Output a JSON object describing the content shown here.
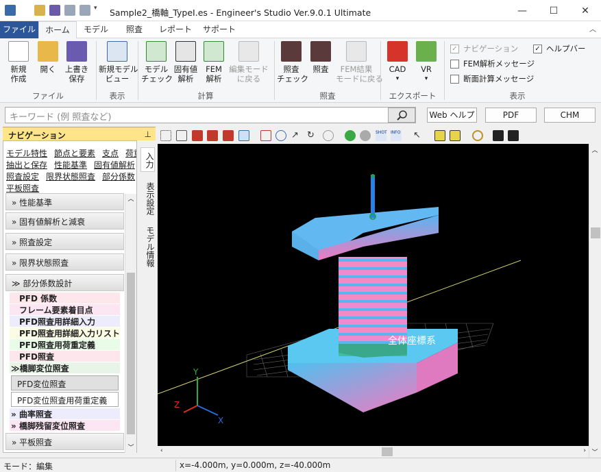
{
  "window": {
    "title": "Sample2_橋軸_TypeI.es - Engineer's Studio Ver.9.0.1 Ultimate",
    "min_icon": "minimize-icon",
    "max_icon": "maximize-icon",
    "close_icon": "close-icon"
  },
  "menu": {
    "tabs": [
      "ファイル",
      "ホーム",
      "モデル",
      "照査",
      "レポート",
      "サポート"
    ]
  },
  "ribbon": {
    "buttons": [
      "新規\n作成",
      "開く",
      "上書き\n保存",
      "新規モデル\nビュー",
      "モデル\nチェック",
      "固有値\n解析",
      "FEM\n解析",
      "編集モード\nに戻る",
      "照査\nチェック",
      "照査",
      "FEM結果\nモードに戻る",
      "CAD",
      "VR"
    ],
    "groups": [
      "ファイル",
      "表示",
      "計算",
      "照査",
      "エクスポート",
      "表示"
    ],
    "checks": {
      "navigation": "ナビゲーション",
      "help_bar": "ヘルプバー",
      "fem_msg": "FEM解析メッセージ",
      "section_msg": "断面計算メッセージ"
    }
  },
  "search": {
    "placeholder": "キーワード (例 照査など)",
    "web_help": "Web ヘルプ",
    "pdf": "PDF",
    "chm": "CHM"
  },
  "nav": {
    "header": "ナビゲーション",
    "links": [
      "モデル特性",
      "節点と要素",
      "支点",
      "荷重",
      "抽出と保存",
      "性能基準",
      "固有値解析",
      "照査設定",
      "限界状態照査",
      "部分係数",
      "平板照査"
    ],
    "sections": [
      "性能基準",
      "固有値解析と減衰",
      "照査設定",
      "限界状態照査",
      "部分係数設計"
    ],
    "items": [
      "PFD 係数",
      "フレーム要素着目点",
      "PFD照査用詳細入力",
      "PFD照査用詳細入力リスト",
      "PFD照査用荷重定義",
      "PFD照査"
    ],
    "expanded": "橋脚変位照査",
    "sub_items": [
      "PFD変位照査",
      "PFD変位照査用荷重定義"
    ],
    "after": [
      "曲率照査",
      "橋脚残留変位照査"
    ],
    "bottom": "平板照査",
    "vtabs": [
      "入力",
      "表示設定",
      "モデル情報"
    ]
  },
  "view": {
    "label": "全体座標系",
    "axes": [
      "X",
      "Y",
      "Z"
    ]
  },
  "status": {
    "mode": "モード：編集",
    "coords": "x=-4.000m, y=0.000m, z=-40.000m"
  }
}
